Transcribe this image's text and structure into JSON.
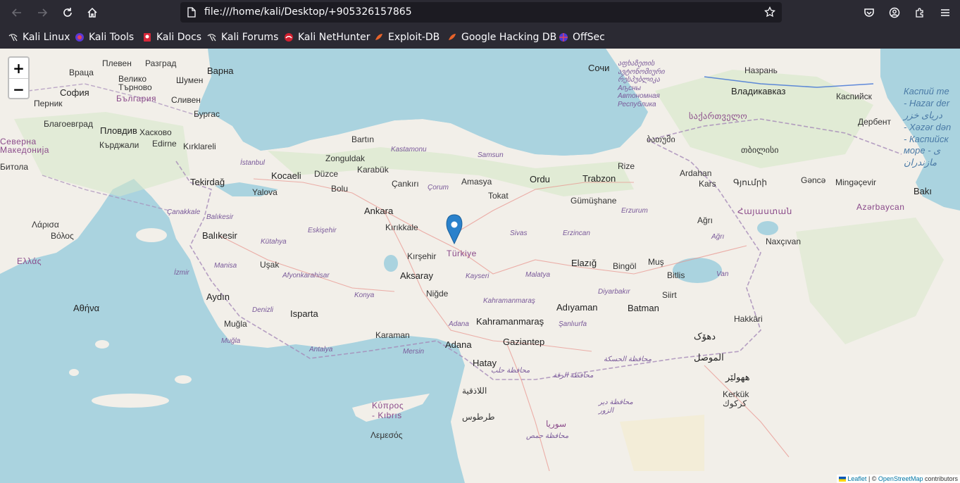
{
  "browser": {
    "url": "file:///home/kali/Desktop/+905326157865",
    "bookmarks": [
      {
        "label": "Kali Linux",
        "icon": "kali-dragon-icon"
      },
      {
        "label": "Kali Tools",
        "icon": "kali-tools-icon"
      },
      {
        "label": "Kali Docs",
        "icon": "kali-docs-icon"
      },
      {
        "label": "Kali Forums",
        "icon": "kali-dragon-icon"
      },
      {
        "label": "Kali NetHunter",
        "icon": "nethunter-icon"
      },
      {
        "label": "Exploit-DB",
        "icon": "exploit-db-icon"
      },
      {
        "label": "Google Hacking DB",
        "icon": "exploit-db-icon"
      },
      {
        "label": "OffSec",
        "icon": "offsec-icon"
      }
    ]
  },
  "map": {
    "zoom_in": "+",
    "zoom_out": "−",
    "attribution": {
      "leaflet": "Leaflet",
      "sep": " | © ",
      "osm": "OpenStreetMap",
      "suffix": " contributors"
    },
    "labels": {
      "turkiye": "Türkiye",
      "ankara": "Ankara",
      "aksaray": "Aksaray",
      "kirsehir": "Kırşehir",
      "kirikkale": "Kırıkkale",
      "nigde": "Niğde",
      "kocaeli": "Kocaeli",
      "duzce": "Düzce",
      "bolu": "Bolu",
      "zonguldak": "Zonguldak",
      "karabuk": "Karabük",
      "bartin": "Bartın",
      "kastamonu": "Kastamonu",
      "cankiri": "Çankırı",
      "corum": "Çorum",
      "amasya": "Amasya",
      "samsun": "Samsun",
      "tokat": "Tokat",
      "ordu": "Ordu",
      "trabzon": "Trabzon",
      "gumushane": "Gümüşhane",
      "rize": "Rize",
      "erzurum": "Erzurum",
      "sivas": "Sivas",
      "erzincan": "Erzincan",
      "malatya": "Malatya",
      "elazig": "Elazığ",
      "bingol": "Bingöl",
      "mus": "Muş",
      "bitlis": "Bitlis",
      "van": "Van",
      "siirt": "Siirt",
      "batman": "Batman",
      "diyarbakir": "Diyarbakır",
      "adiyaman": "Adıyaman",
      "kahramanmaras": "Kahramanmaraş",
      "kahramanmaras_prov": "Kahramanmaraş",
      "sanliurfa": "Şanlıurfa",
      "gaziantep": "Gaziantep",
      "adana": "Adana",
      "adana_prov": "Adana",
      "hatay": "Hatay",
      "mersin": "Mersin",
      "karaman": "Karaman",
      "konya": "Konya",
      "kayseri": "Kayseri",
      "antalya": "Antalya",
      "isparta": "Isparta",
      "mugla_city": "Muğla",
      "mugla_prov": "Muğla",
      "denizli": "Denizli",
      "aydin": "Aydın",
      "izmir": "İzmir",
      "manisa": "Manisa",
      "usak": "Uşak",
      "kutahya": "Kütahya",
      "afyon": "Afyonkarahisar",
      "eskisehir": "Eskişehir",
      "balikesir_city": "Balıkesir",
      "balikesir_prov": "Balıkesir",
      "canakkale": "Çanakkale",
      "tekirdag": "Tekirdağ",
      "kirklareli": "Kırklareli",
      "edirne": "Edirne",
      "yalova": "Yalova",
      "istanbul": "İstanbul",
      "burgas": "Бургас",
      "varna": "Варна",
      "shumen": "Шумен",
      "vratsa": "Враца",
      "pleven": "Плевен",
      "razgrad": "Разград",
      "veliko": "Велико\nТърново",
      "sofia": "София",
      "pernik": "Перник",
      "bulgaria": "България",
      "sliven": "Сливен",
      "blagoevgrad": "Благоевград",
      "plovdiv": "Пловдив",
      "haskovo": "Хасково",
      "kardzhali": "Кърджали",
      "macedonia": "Северна\nМакедонија",
      "bitola": "Битола",
      "ellada": "Ελλάς",
      "larisa": "Λάρισα",
      "volos": "Βόλος",
      "athina": "Αθήνα",
      "lemesos": "Λεμεσός",
      "kypros": "Κύπρος\n- Kıbrıs",
      "sochi": "Сочи",
      "abkhazia": "აფხაზეთის\nავტონომიური\nრესპუბლიკა\nАҧсны\nАвтономная\nРеспублика",
      "batumi": "ბათუმი",
      "sakartvelo": "საქართველო",
      "tbilisi": "თბილისი",
      "hayastan": "Հայաստան",
      "gyumri": "Գյումրի",
      "vladikavkaz": "Владикавказ",
      "nazran": "Назрань",
      "kaspiysk": "Каспийск",
      "derbent": "Дербент",
      "ganca": "Gəncə",
      "mingachevir": "Mingəçevir",
      "baki": "Bakı",
      "azerbaycan": "Azərbaycan",
      "ardahan": "Ardahan",
      "kars": "Kars",
      "agri": "Ağrı",
      "agri_prov": "Ağrı",
      "nakhchivan": "Naxçıvan",
      "hakkari": "Hakkâri",
      "duhok": "دهۆک",
      "mosul": "الموصل",
      "erbil": "ههولێر",
      "kirkuk": "Kerkük\nكركوك",
      "suriye": "سوريا",
      "halab": "محافظة حلب",
      "raqqa": "محافظة الرقة",
      "hasakah": "محافظة الحسكة",
      "latakia": "اللاذقية",
      "tartus": "طرطوس",
      "homs": "محافظة حمص",
      "deir": "محافظة دير\nالزور",
      "caspian": "Каспий те\n- Hazar der\nدریای خزر\n- Xəzər dən\n- Каспийск\nморе - ی\nمازندران"
    }
  }
}
